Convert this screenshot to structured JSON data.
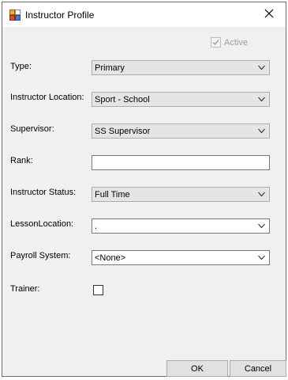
{
  "window": {
    "title": "Instructor Profile"
  },
  "active": {
    "label": "Active",
    "checked": true,
    "enabled": false
  },
  "fields": {
    "type": {
      "label": "Type:",
      "value": "Primary"
    },
    "instructor_location": {
      "label": "Instructor Location:",
      "value": "Sport - School"
    },
    "supervisor": {
      "label": "Supervisor:",
      "value": "SS Supervisor"
    },
    "rank": {
      "label": "Rank:",
      "value": ""
    },
    "instructor_status": {
      "label": "Instructor Status:",
      "value": "Full Time"
    },
    "lesson_location": {
      "label": "LessonLocation:",
      "value": "."
    },
    "payroll_system": {
      "label": "Payroll System:",
      "value": "<None>"
    },
    "trainer": {
      "label": "Trainer:",
      "checked": false
    }
  },
  "buttons": {
    "ok": "OK",
    "cancel": "Cancel"
  }
}
